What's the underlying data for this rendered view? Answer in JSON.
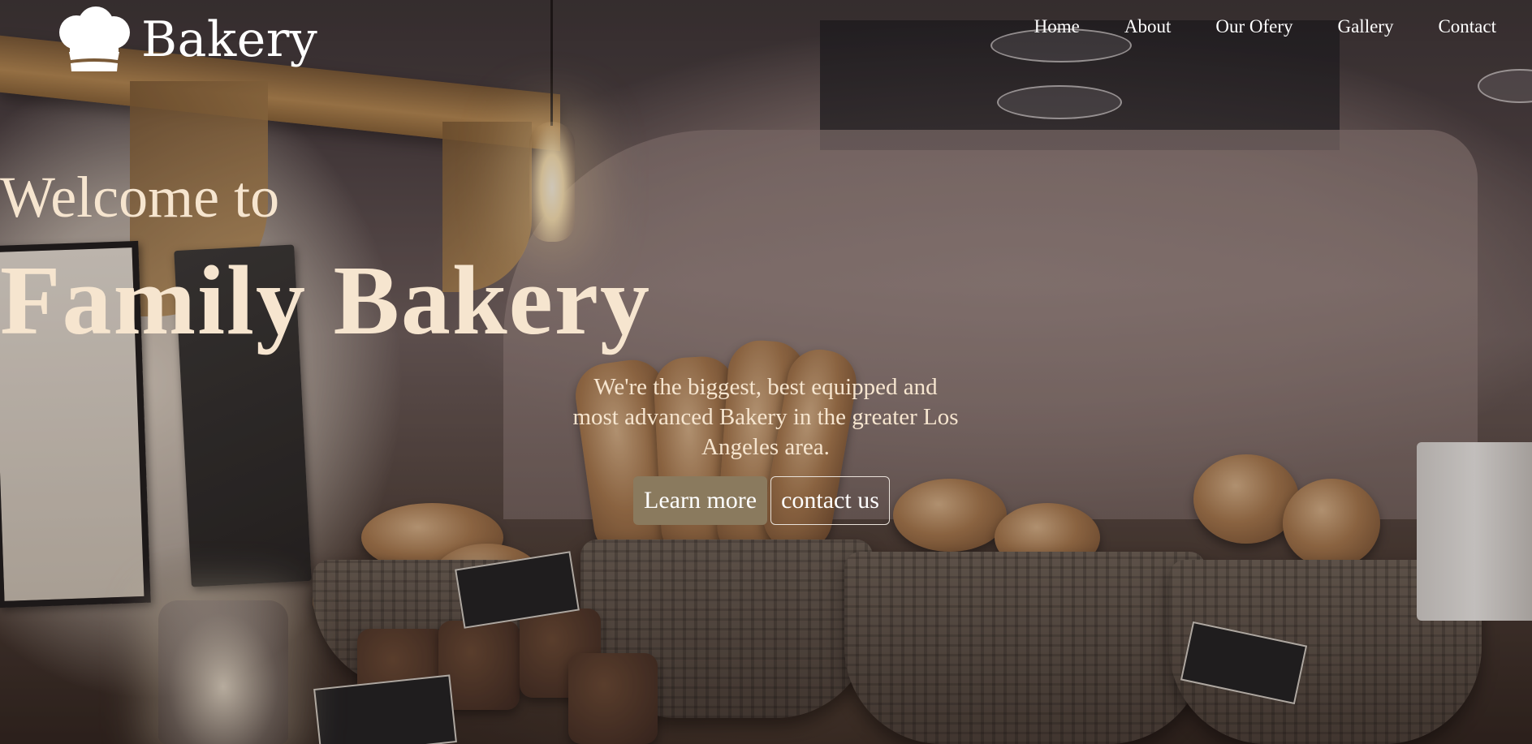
{
  "brand": {
    "name": "Bakery",
    "logo_icon": "chef-hat-icon"
  },
  "nav": {
    "items": [
      {
        "label": "Home"
      },
      {
        "label": "About"
      },
      {
        "label": "Our Ofery"
      },
      {
        "label": "Gallery"
      },
      {
        "label": "Contact"
      }
    ]
  },
  "hero": {
    "welcome": "Welcome to",
    "title": "Family Bakery",
    "tagline": "We're the biggest, best equipped and most advanced Bakery in the greater Los Angeles area.",
    "primary_button": "Learn more",
    "secondary_button": "contact us"
  },
  "colors": {
    "hero_text": "#f6e5cf",
    "primary_button_bg": "#8a7a5e",
    "nav_text": "#ffffff"
  }
}
